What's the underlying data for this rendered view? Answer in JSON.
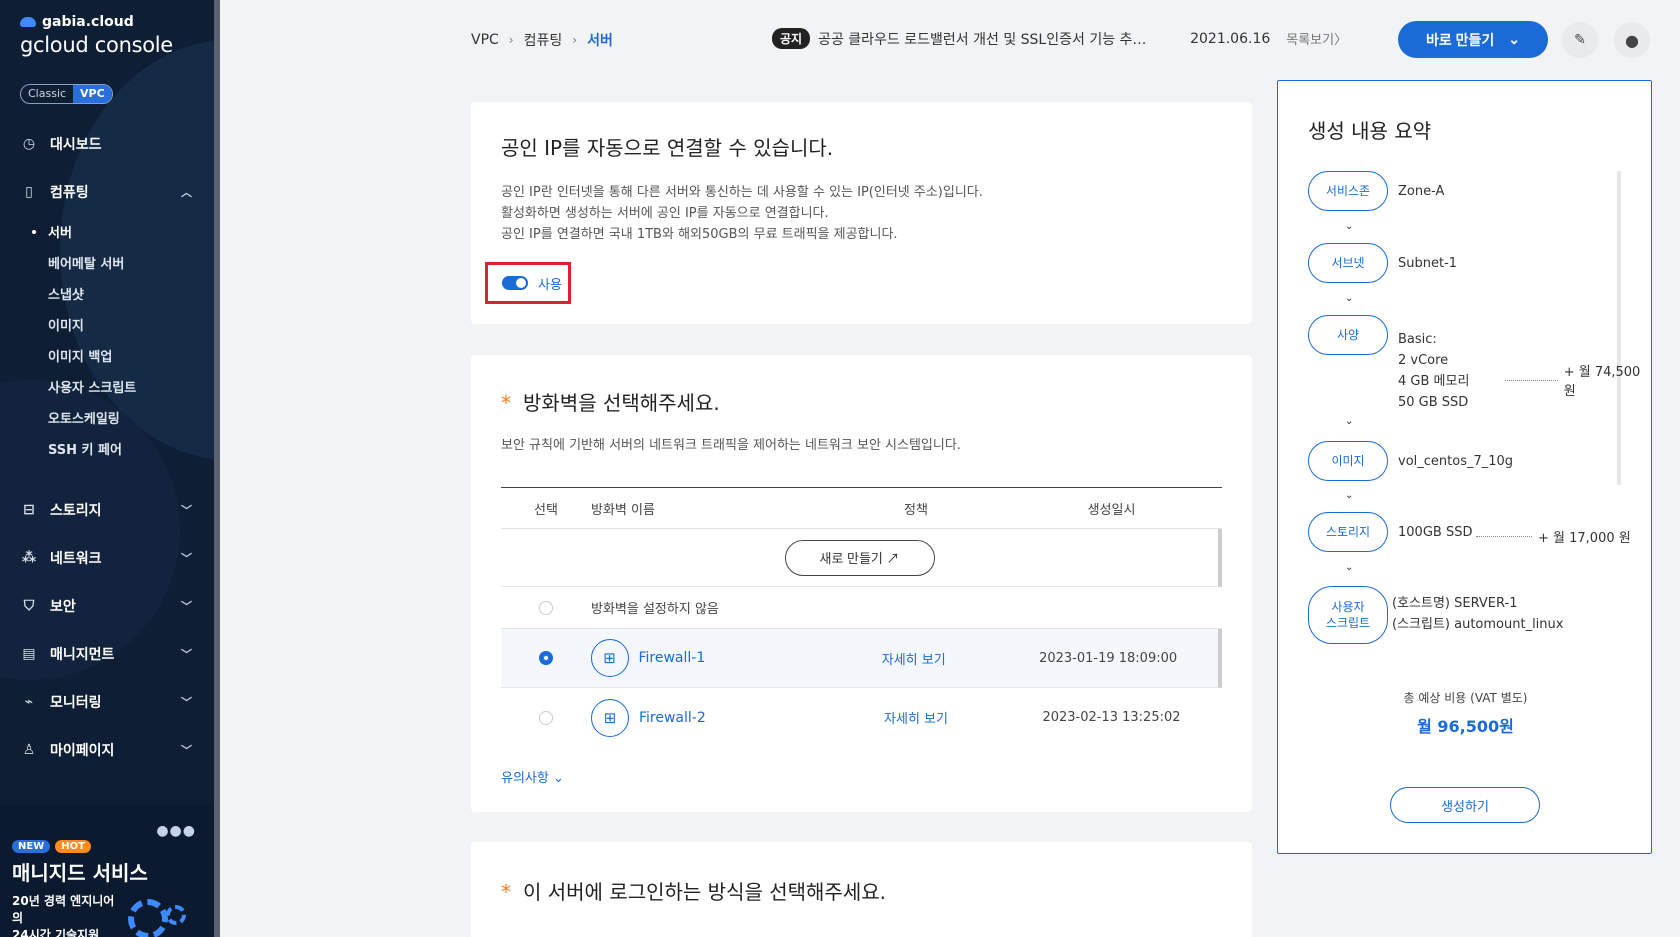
{
  "brand": {
    "company": "gabia.cloud",
    "product": "gcloud console"
  },
  "env_switch": {
    "classic": "Classic",
    "vpc": "VPC"
  },
  "nav": {
    "dashboard": "대시보드",
    "computing": "컴퓨팅",
    "computing_sub": [
      "서버",
      "베어메탈 서버",
      "스냅샷",
      "이미지",
      "이미지 백업",
      "사용자 스크립트",
      "오토스케일링",
      "SSH 키 페어"
    ],
    "storage": "스토리지",
    "network": "네트워크",
    "security": "보안",
    "management": "매니지먼트",
    "monitoring": "모니터링",
    "mypage": "마이페이지"
  },
  "promo": {
    "badge_new": "NEW",
    "badge_hot": "HOT",
    "title": "매니지드 서비스",
    "sub_line1": "20년 경력 엔지니어의",
    "sub_line2": "24시간 기술지원"
  },
  "breadcrumb": [
    "VPC",
    "컴퓨팅",
    "서버"
  ],
  "notice": {
    "tag": "공지",
    "text": "공공 클라우드 로드밸런서 개선 및 SSL인증서 기능 추…",
    "date": "2021.06.16",
    "more": "목록보기〉"
  },
  "header": {
    "create_label": "바로 만들기"
  },
  "public_ip": {
    "title": "공인 IP를 자동으로 연결할 수 있습니다.",
    "desc1": "공인 IP란 인터넷을 통해 다른 서버와 통신하는 데 사용할 수 있는 IP(인터넷 주소)입니다.",
    "desc2": "활성화하면 생성하는 서버에 공인 IP를 자동으로 연결합니다.",
    "desc3": "공인 IP를 연결하면 국내 1TB와 해외50GB의 무료 트래픽을 제공합니다.",
    "toggle_label": "사용",
    "enabled": true
  },
  "firewall": {
    "title": "방화벽을 선택해주세요.",
    "desc": "보안 규칙에 기반해 서버의 네트워크 트래픽을 제어하는 네트워크 보안 시스템입니다.",
    "columns": {
      "select": "선택",
      "name": "방화벽 이름",
      "policy": "정책",
      "created": "생성일시"
    },
    "new_button": "새로 만들기 ↗",
    "none_option": "방화벽을 설정하지 않음",
    "rows": [
      {
        "name": "Firewall-1",
        "policy": "자세히 보기",
        "created": "2023-01-19 18:09:00",
        "selected": true
      },
      {
        "name": "Firewall-2",
        "policy": "자세히 보기",
        "created": "2023-02-13 13:25:02",
        "selected": false
      }
    ],
    "caution": "유의사항"
  },
  "login": {
    "title": "이 서버에 로그인하는 방식을 선택해주세요."
  },
  "summary": {
    "title": "생성 내용 요약",
    "steps": [
      {
        "label": "서비스존",
        "lines": [
          "Zone-A"
        ]
      },
      {
        "label": "서브넷",
        "lines": [
          "Subnet-1"
        ]
      },
      {
        "label": "사양",
        "lines": [
          "Basic:",
          "2 vCore",
          "4 GB 메모리",
          "50 GB SSD"
        ],
        "price": "+ 월 74,500 원"
      },
      {
        "label": "이미지",
        "lines": [
          "vol_centos_7_10g"
        ]
      },
      {
        "label": "스토리지",
        "lines": [
          "100GB SSD"
        ],
        "price": "+ 월 17,000 원"
      },
      {
        "label_line1": "사용자",
        "label_line2": "스크립트",
        "lines": [
          "(호스트명) SERVER-1",
          "(스크립트) automount_linux"
        ]
      }
    ],
    "total_label": "총 예상 비용 (VAT 별도)",
    "total_value": "월 96,500원",
    "submit": "생성하기"
  },
  "colors": {
    "accent": "#1a6ad8",
    "sidebar": "#0e1e34",
    "highlight": "#e0202e",
    "required": "#ff7a1a"
  }
}
